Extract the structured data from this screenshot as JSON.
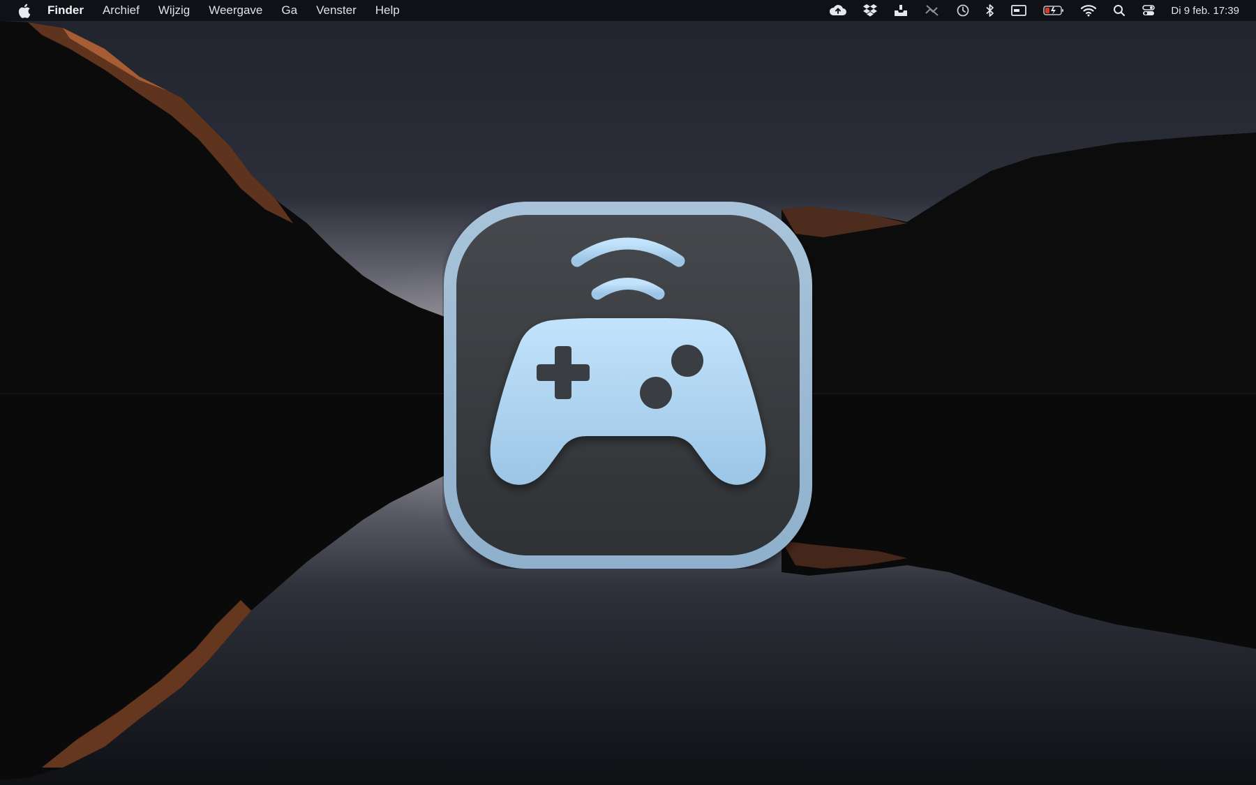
{
  "menubar": {
    "apple_icon": "apple-logo-icon",
    "items": [
      {
        "label": "Finder",
        "bold": true
      },
      {
        "label": "Archief"
      },
      {
        "label": "Wijzig"
      },
      {
        "label": "Weergave"
      },
      {
        "label": "Ga"
      },
      {
        "label": "Venster"
      },
      {
        "label": "Help"
      }
    ],
    "status_icons": [
      "cloud-upload-icon",
      "dropbox-icon",
      "inbox-tray-icon",
      "crossed-out-icon",
      "time-machine-icon",
      "bluetooth-icon",
      "display-icon",
      "battery-charging-icon",
      "wifi-icon",
      "spotlight-search-icon",
      "control-center-icon"
    ],
    "clock": "Di 9 feb.  17:39"
  },
  "app_icon": {
    "name": "game-controller-app-icon",
    "colors": {
      "frame": "#a8c4dc",
      "background": "#3a3d41",
      "controller": "#b7dcf7"
    }
  },
  "colors": {
    "sky_top": "#22262f",
    "sky_glow": "#8e8fa0",
    "water": "#0b0c10",
    "rock_highlight": "#b8683a"
  }
}
